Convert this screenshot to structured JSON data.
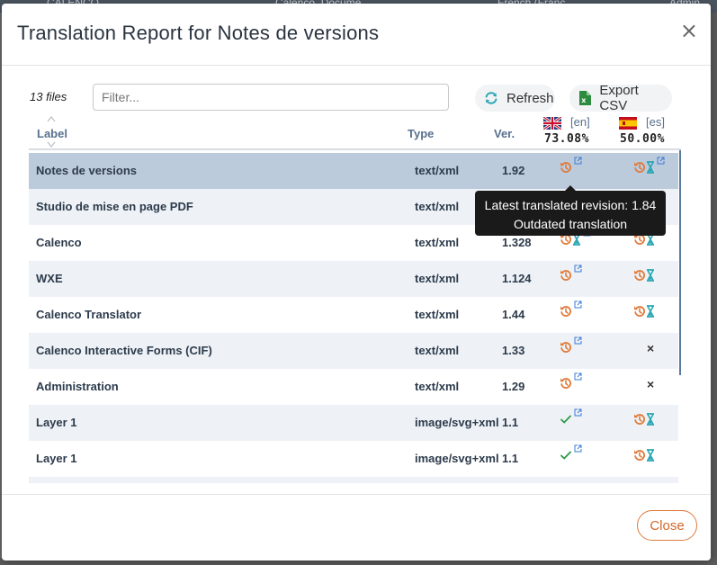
{
  "modal": {
    "title": "Translation Report for Notes de versions",
    "close_symbol": "×"
  },
  "toolbar": {
    "files_count": "13 files",
    "filter_placeholder": "Filter...",
    "refresh_label": "Refresh",
    "export_label": "Export CSV",
    "refresh_icon": "refresh-icon",
    "export_icon": "excel-file-icon"
  },
  "columns": {
    "label": "Label",
    "type": "Type",
    "ver": "Ver."
  },
  "languages": [
    {
      "code": "[en]",
      "percent": "73.08%",
      "flag": "uk-flag-icon"
    },
    {
      "code": "[es]",
      "percent": "50.00%",
      "flag": "spain-flag-icon"
    }
  ],
  "rows": [
    {
      "label": "Notes de versions",
      "type": "text/xml",
      "ver": "1.92",
      "en": "outdated",
      "es": "outdated-pending"
    },
    {
      "label": "Studio de mise en page PDF",
      "type": "text/xml",
      "ver": "",
      "en": "hidden",
      "es": "hidden"
    },
    {
      "label": "Calenco",
      "type": "text/xml",
      "ver": "1.328",
      "en": "outdated-pending",
      "es": "outdated-pending"
    },
    {
      "label": "WXE",
      "type": "text/xml",
      "ver": "1.124",
      "en": "outdated",
      "es": "outdated-pending"
    },
    {
      "label": "Calenco Translator",
      "type": "text/xml",
      "ver": "1.44",
      "en": "outdated",
      "es": "outdated-pending"
    },
    {
      "label": "Calenco Interactive Forms (CIF)",
      "type": "text/xml",
      "ver": "1.33",
      "en": "outdated",
      "es": "missing"
    },
    {
      "label": "Administration",
      "type": "text/xml",
      "ver": "1.29",
      "en": "outdated",
      "es": "missing"
    },
    {
      "label": "Layer 1",
      "type": "image/svg+xml",
      "ver": "1.1",
      "en": "uptodate",
      "es": "outdated-pending"
    },
    {
      "label": "Layer 1",
      "type": "image/svg+xml",
      "ver": "1.1",
      "en": "uptodate",
      "es": "outdated-pending"
    }
  ],
  "tooltip": {
    "line1": "Latest translated revision: 1.84",
    "line2": "Outdated translation"
  },
  "footer": {
    "close_label": "Close"
  },
  "background": {
    "left_text": "CALENCO",
    "mid_text": "Calenco_Docume...",
    "lang_text": "French (Franc...",
    "right_text": "Admin"
  },
  "colors": {
    "accent_orange": "#e07a3a",
    "teal": "#2aa6b3",
    "green": "#2e9a4a",
    "link_blue": "#3a7bd5",
    "selected_row": "#bccbdc"
  }
}
